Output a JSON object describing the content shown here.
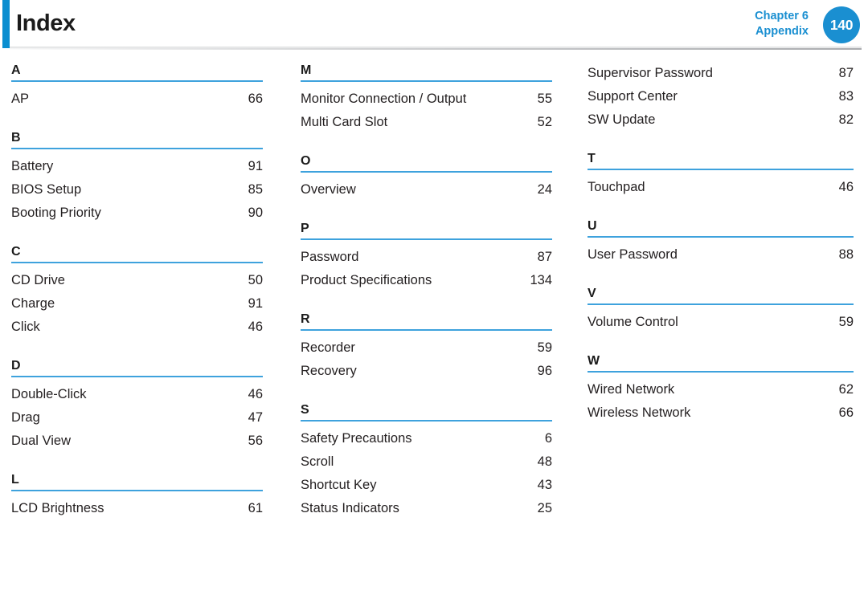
{
  "header": {
    "title": "Index",
    "chapter_line1": "Chapter 6",
    "chapter_line2": "Appendix",
    "page_number": "140",
    "accent_color": "#0a8ed0",
    "badge_color": "#1a8fd1",
    "rule_color": "#3ea2dd"
  },
  "columns": [
    {
      "groups": [
        {
          "letter": "A",
          "entries": [
            {
              "title": "AP",
              "page": "66"
            }
          ]
        },
        {
          "letter": "B",
          "entries": [
            {
              "title": "Battery",
              "page": "91"
            },
            {
              "title": "BIOS Setup",
              "page": "85"
            },
            {
              "title": "Booting Priority",
              "page": "90"
            }
          ]
        },
        {
          "letter": "C",
          "entries": [
            {
              "title": "CD Drive",
              "page": "50"
            },
            {
              "title": "Charge",
              "page": "91"
            },
            {
              "title": "Click",
              "page": "46"
            }
          ]
        },
        {
          "letter": "D",
          "entries": [
            {
              "title": "Double-Click",
              "page": "46"
            },
            {
              "title": "Drag",
              "page": "47"
            },
            {
              "title": "Dual View",
              "page": "56"
            }
          ]
        },
        {
          "letter": "L",
          "entries": [
            {
              "title": "LCD Brightness",
              "page": "61"
            }
          ]
        }
      ]
    },
    {
      "groups": [
        {
          "letter": "M",
          "entries": [
            {
              "title": "Monitor Connection / Output",
              "page": "55"
            },
            {
              "title": "Multi Card Slot",
              "page": "52"
            }
          ]
        },
        {
          "letter": "O",
          "entries": [
            {
              "title": "Overview",
              "page": "24"
            }
          ]
        },
        {
          "letter": "P",
          "entries": [
            {
              "title": "Password",
              "page": "87"
            },
            {
              "title": "Product Specifications",
              "page": "134"
            }
          ]
        },
        {
          "letter": "R",
          "entries": [
            {
              "title": "Recorder",
              "page": "59"
            },
            {
              "title": "Recovery",
              "page": "96"
            }
          ]
        },
        {
          "letter": "S",
          "entries": [
            {
              "title": "Safety Precautions",
              "page": "6"
            },
            {
              "title": "Scroll",
              "page": "48"
            },
            {
              "title": "Shortcut Key",
              "page": "43"
            },
            {
              "title": "Status Indicators",
              "page": "25"
            }
          ]
        }
      ]
    },
    {
      "groups": [
        {
          "letter": "",
          "entries": [
            {
              "title": "Supervisor Password",
              "page": "87"
            },
            {
              "title": "Support Center",
              "page": "83"
            },
            {
              "title": "SW Update",
              "page": "82"
            }
          ]
        },
        {
          "letter": "T",
          "entries": [
            {
              "title": "Touchpad",
              "page": "46"
            }
          ]
        },
        {
          "letter": "U",
          "entries": [
            {
              "title": "User Password",
              "page": "88"
            }
          ]
        },
        {
          "letter": "V",
          "entries": [
            {
              "title": "Volume Control",
              "page": "59"
            }
          ]
        },
        {
          "letter": "W",
          "entries": [
            {
              "title": "Wired Network",
              "page": "62"
            },
            {
              "title": "Wireless Network",
              "page": "66"
            }
          ]
        }
      ]
    }
  ]
}
